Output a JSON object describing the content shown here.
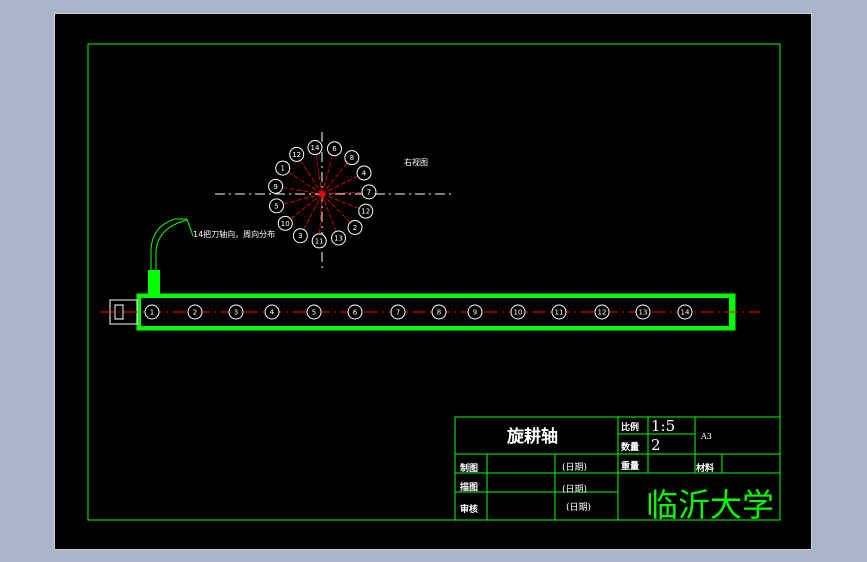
{
  "title_block": {
    "part_name": "旋耕轴",
    "scale_label": "比例",
    "scale_value": "1:5",
    "qty_label": "数量",
    "qty_value": "2",
    "sheet_size": "A3",
    "weight_label": "重量",
    "material_label": "材料",
    "drawn_label": "制图",
    "drawn_date": "(日期)",
    "drafted_label": "描图",
    "drafted_date": "(日期)",
    "review_label": "审核",
    "review_date": "(日期)",
    "school": "临沂大学"
  },
  "view": {
    "view_label": "右视图",
    "callout": "14把刀轴向，周向分布",
    "circle_numbers": [
      "1",
      "2",
      "3",
      "4",
      "5",
      "6",
      "7",
      "8",
      "9",
      "10",
      "11",
      "12",
      "13",
      "14"
    ],
    "radial_numbers": [
      "14",
      "6",
      "8",
      "4",
      "7",
      "12",
      "2",
      "13",
      "11",
      "3",
      "10",
      "5",
      "9",
      "1",
      "12"
    ]
  },
  "colors": {
    "border": "#00ff00",
    "line": "#ffffff",
    "center": "#ff0000",
    "hatch": "#00ff00"
  }
}
